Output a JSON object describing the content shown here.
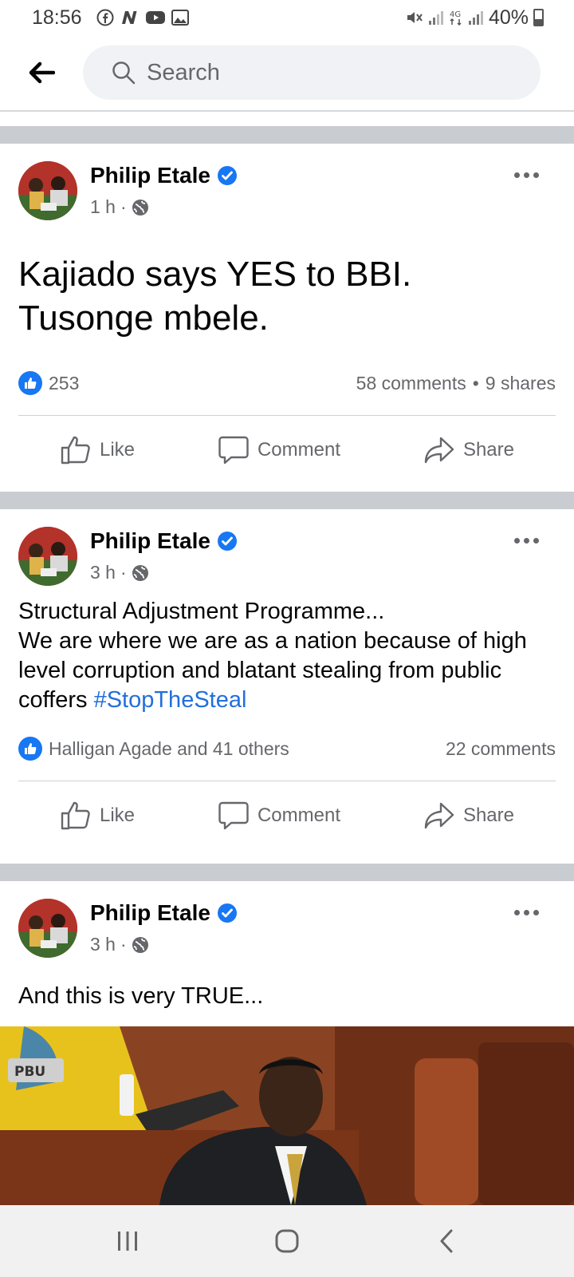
{
  "status_bar": {
    "time": "18:56",
    "battery": "40%",
    "left_icons": [
      "facebook-icon",
      "n-app-icon",
      "youtube-icon",
      "gallery-icon"
    ],
    "right_icons": [
      "mute-icon",
      "signal-icon",
      "4g-icon",
      "signal-icon-2",
      "battery-icon"
    ]
  },
  "top_bar": {
    "search_placeholder": "Search"
  },
  "colors": {
    "brand_blue": "#1877f2",
    "hashtag": "#216fdb",
    "divider": "#c9ccd1",
    "search_bg": "#f0f2f5",
    "muted_text": "#65676b"
  },
  "posts": [
    {
      "author": "Philip Etale",
      "verified": true,
      "time": "1 h",
      "separator": "·",
      "audience": "globe-icon",
      "text": "Kajiado says YES to BBI. Tusonge mbele.",
      "reactions": "253",
      "comments": "58 comments",
      "shares": "9 shares",
      "counts_separator": "•",
      "actions": {
        "like": "Like",
        "comment": "Comment",
        "share": "Share"
      }
    },
    {
      "author": "Philip Etale",
      "verified": true,
      "time": "3 h",
      "separator": "·",
      "audience": "globe-icon",
      "text": "Structural Adjustment Programme...\nWe are where we are as a nation because of high level corruption and blatant stealing from public coffers ",
      "hashtag": "#StopTheSteal",
      "reactions": "Halligan Agade and 41 others",
      "comments": "22 comments",
      "actions": {
        "like": "Like",
        "comment": "Comment",
        "share": "Share"
      }
    },
    {
      "author": "Philip Etale",
      "verified": true,
      "time": "3 h",
      "separator": "·",
      "audience": "globe-icon",
      "text": "And this is very TRUE...",
      "image_overlay_text": "PBU"
    }
  ],
  "nav_bar": {
    "buttons": [
      "recent-apps-icon",
      "home-icon",
      "back-icon"
    ]
  }
}
